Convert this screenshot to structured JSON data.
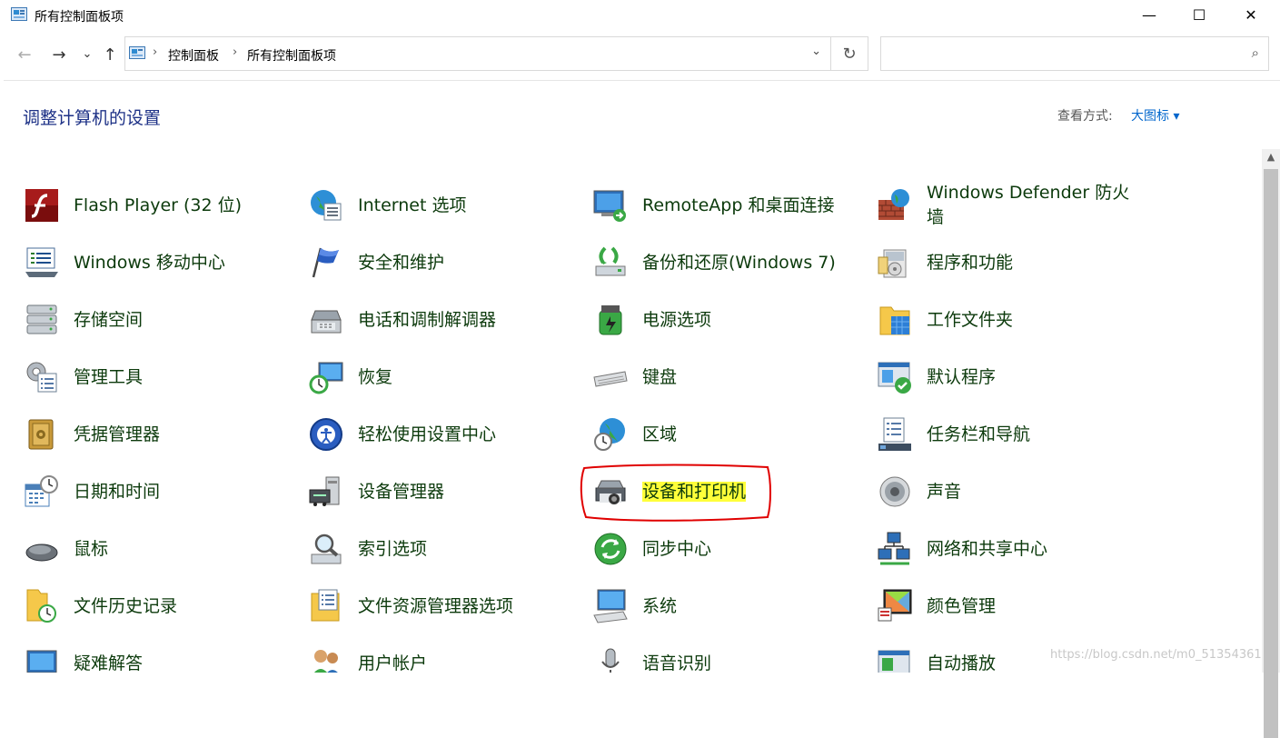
{
  "window": {
    "title": "所有控制面板项",
    "minimize": "—",
    "maximize": "☐",
    "close": "✕"
  },
  "nav": {
    "back": "←",
    "forward": "→",
    "recent": "⌄",
    "up": "↑"
  },
  "address": {
    "crumbs": [
      "控制面板",
      "所有控制面板项"
    ],
    "separator": "›",
    "dropdown": "⌄",
    "refresh": "↻"
  },
  "search": {
    "placeholder": "",
    "icon": "⌕"
  },
  "header": {
    "title": "调整计算机的设置",
    "view_by_label": "查看方式:",
    "view_by_value": "大图标 ▾"
  },
  "items": [
    {
      "label": "Flash Player (32 位)",
      "icon": "flash-player-icon"
    },
    {
      "label": "Internet 选项",
      "icon": "internet-options-icon"
    },
    {
      "label": "RemoteApp 和桌面连接",
      "icon": "remoteapp-icon"
    },
    {
      "label": "Windows Defender 防火墙",
      "icon": "firewall-icon"
    },
    {
      "label": "Windows 移动中心",
      "icon": "mobility-center-icon"
    },
    {
      "label": "安全和维护",
      "icon": "security-flag-icon"
    },
    {
      "label": "备份和还原(Windows 7)",
      "icon": "backup-icon"
    },
    {
      "label": "程序和功能",
      "icon": "programs-icon"
    },
    {
      "label": "存储空间",
      "icon": "storage-icon"
    },
    {
      "label": "电话和调制解调器",
      "icon": "phone-modem-icon"
    },
    {
      "label": "电源选项",
      "icon": "power-icon"
    },
    {
      "label": "工作文件夹",
      "icon": "work-folders-icon"
    },
    {
      "label": "管理工具",
      "icon": "admin-tools-icon"
    },
    {
      "label": "恢复",
      "icon": "recovery-icon"
    },
    {
      "label": "键盘",
      "icon": "keyboard-icon"
    },
    {
      "label": "默认程序",
      "icon": "default-programs-icon"
    },
    {
      "label": "凭据管理器",
      "icon": "credential-icon"
    },
    {
      "label": "轻松使用设置中心",
      "icon": "ease-of-access-icon"
    },
    {
      "label": "区域",
      "icon": "region-icon"
    },
    {
      "label": "任务栏和导航",
      "icon": "taskbar-icon"
    },
    {
      "label": "日期和时间",
      "icon": "date-time-icon"
    },
    {
      "label": "设备管理器",
      "icon": "device-manager-icon"
    },
    {
      "label": "设备和打印机",
      "icon": "printer-icon"
    },
    {
      "label": "声音",
      "icon": "sound-icon"
    },
    {
      "label": "鼠标",
      "icon": "mouse-icon"
    },
    {
      "label": "索引选项",
      "icon": "indexing-icon"
    },
    {
      "label": "同步中心",
      "icon": "sync-icon"
    },
    {
      "label": "网络和共享中心",
      "icon": "network-icon"
    },
    {
      "label": "文件历史记录",
      "icon": "file-history-icon"
    },
    {
      "label": "文件资源管理器选项",
      "icon": "explorer-options-icon"
    },
    {
      "label": "系统",
      "icon": "system-icon"
    },
    {
      "label": "颜色管理",
      "icon": "color-management-icon"
    },
    {
      "label": "疑难解答",
      "icon": "troubleshooting-icon"
    },
    {
      "label": "用户帐户",
      "icon": "user-accounts-icon"
    },
    {
      "label": "语音识别",
      "icon": "speech-icon"
    },
    {
      "label": "自动播放",
      "icon": "autoplay-icon"
    }
  ],
  "watermark": "https://blog.csdn.net/m0_51354361",
  "colors": {
    "heading": "#1e3287",
    "link": "#0066cc",
    "highlight": "#ffff3a",
    "annotation": "#e00000"
  }
}
